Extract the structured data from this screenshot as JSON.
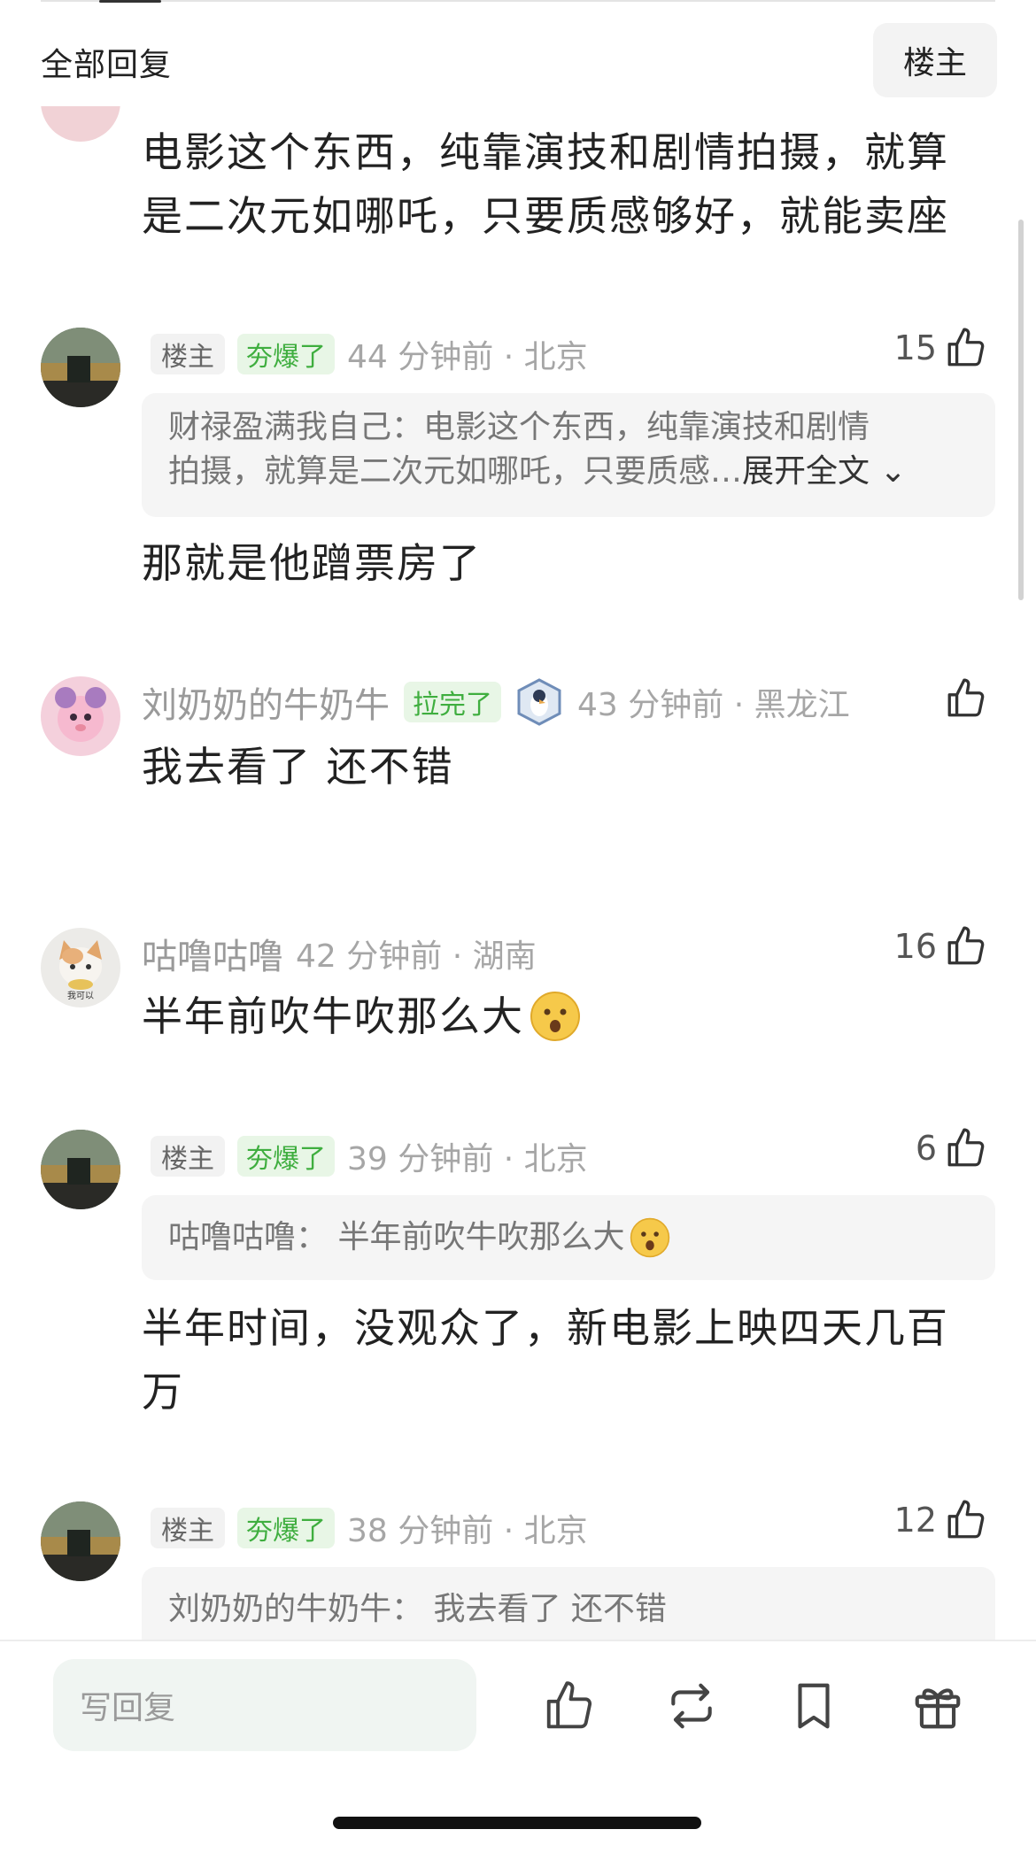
{
  "header": {
    "title": "全部回复",
    "poster_button": "楼主"
  },
  "first_comment": {
    "lines": [
      "电影这个东西，纯靠演技和剧情拍摄，就算",
      "是二次元如哪吒，只要质感够好，就能卖座"
    ]
  },
  "comments": [
    {
      "tag1": "楼主",
      "tag2": "夯爆了",
      "meta": "44 分钟前 · 北京",
      "likes": "15",
      "quote_line1": "财禄盈满我自己：电影这个东西，纯靠演技和剧情",
      "quote_line2": "拍摄，就算是二次元如哪吒，只要质感…",
      "expand": "展开全文",
      "text": "那就是他蹭票房了"
    },
    {
      "name": "刘奶奶的牛奶牛",
      "tag2": "拉完了",
      "meta": "43 分钟前 · 黑龙江",
      "likes": "",
      "text": "我去看了 还不错"
    },
    {
      "name": "咕噜咕噜",
      "meta": "42 分钟前 · 湖南",
      "likes": "16",
      "text": "半年前吹牛吹那么大",
      "avatar_caption": "我可以"
    },
    {
      "tag1": "楼主",
      "tag2": "夯爆了",
      "meta": "39 分钟前 · 北京",
      "likes": "6",
      "quote_line1": "咕噜咕噜：  半年前吹牛吹那么大",
      "text_line1": "半年时间，没观众了，新电影上映四天几百",
      "text_line2": "万"
    },
    {
      "tag1": "楼主",
      "tag2": "夯爆了",
      "meta": "38 分钟前 · 北京",
      "likes": "12",
      "quote_line1": "刘奶奶的牛奶牛：  我去看了 还不错"
    }
  ],
  "bottom": {
    "reply_placeholder": "写回复",
    "icons": [
      "thumb-up-icon",
      "repost-icon",
      "bookmark-icon",
      "gift-icon"
    ]
  },
  "colors": {
    "green_tag_bg": "#e8f6e6",
    "green_tag_text": "#3fae3f",
    "meta_grey": "#a6a6a6"
  }
}
